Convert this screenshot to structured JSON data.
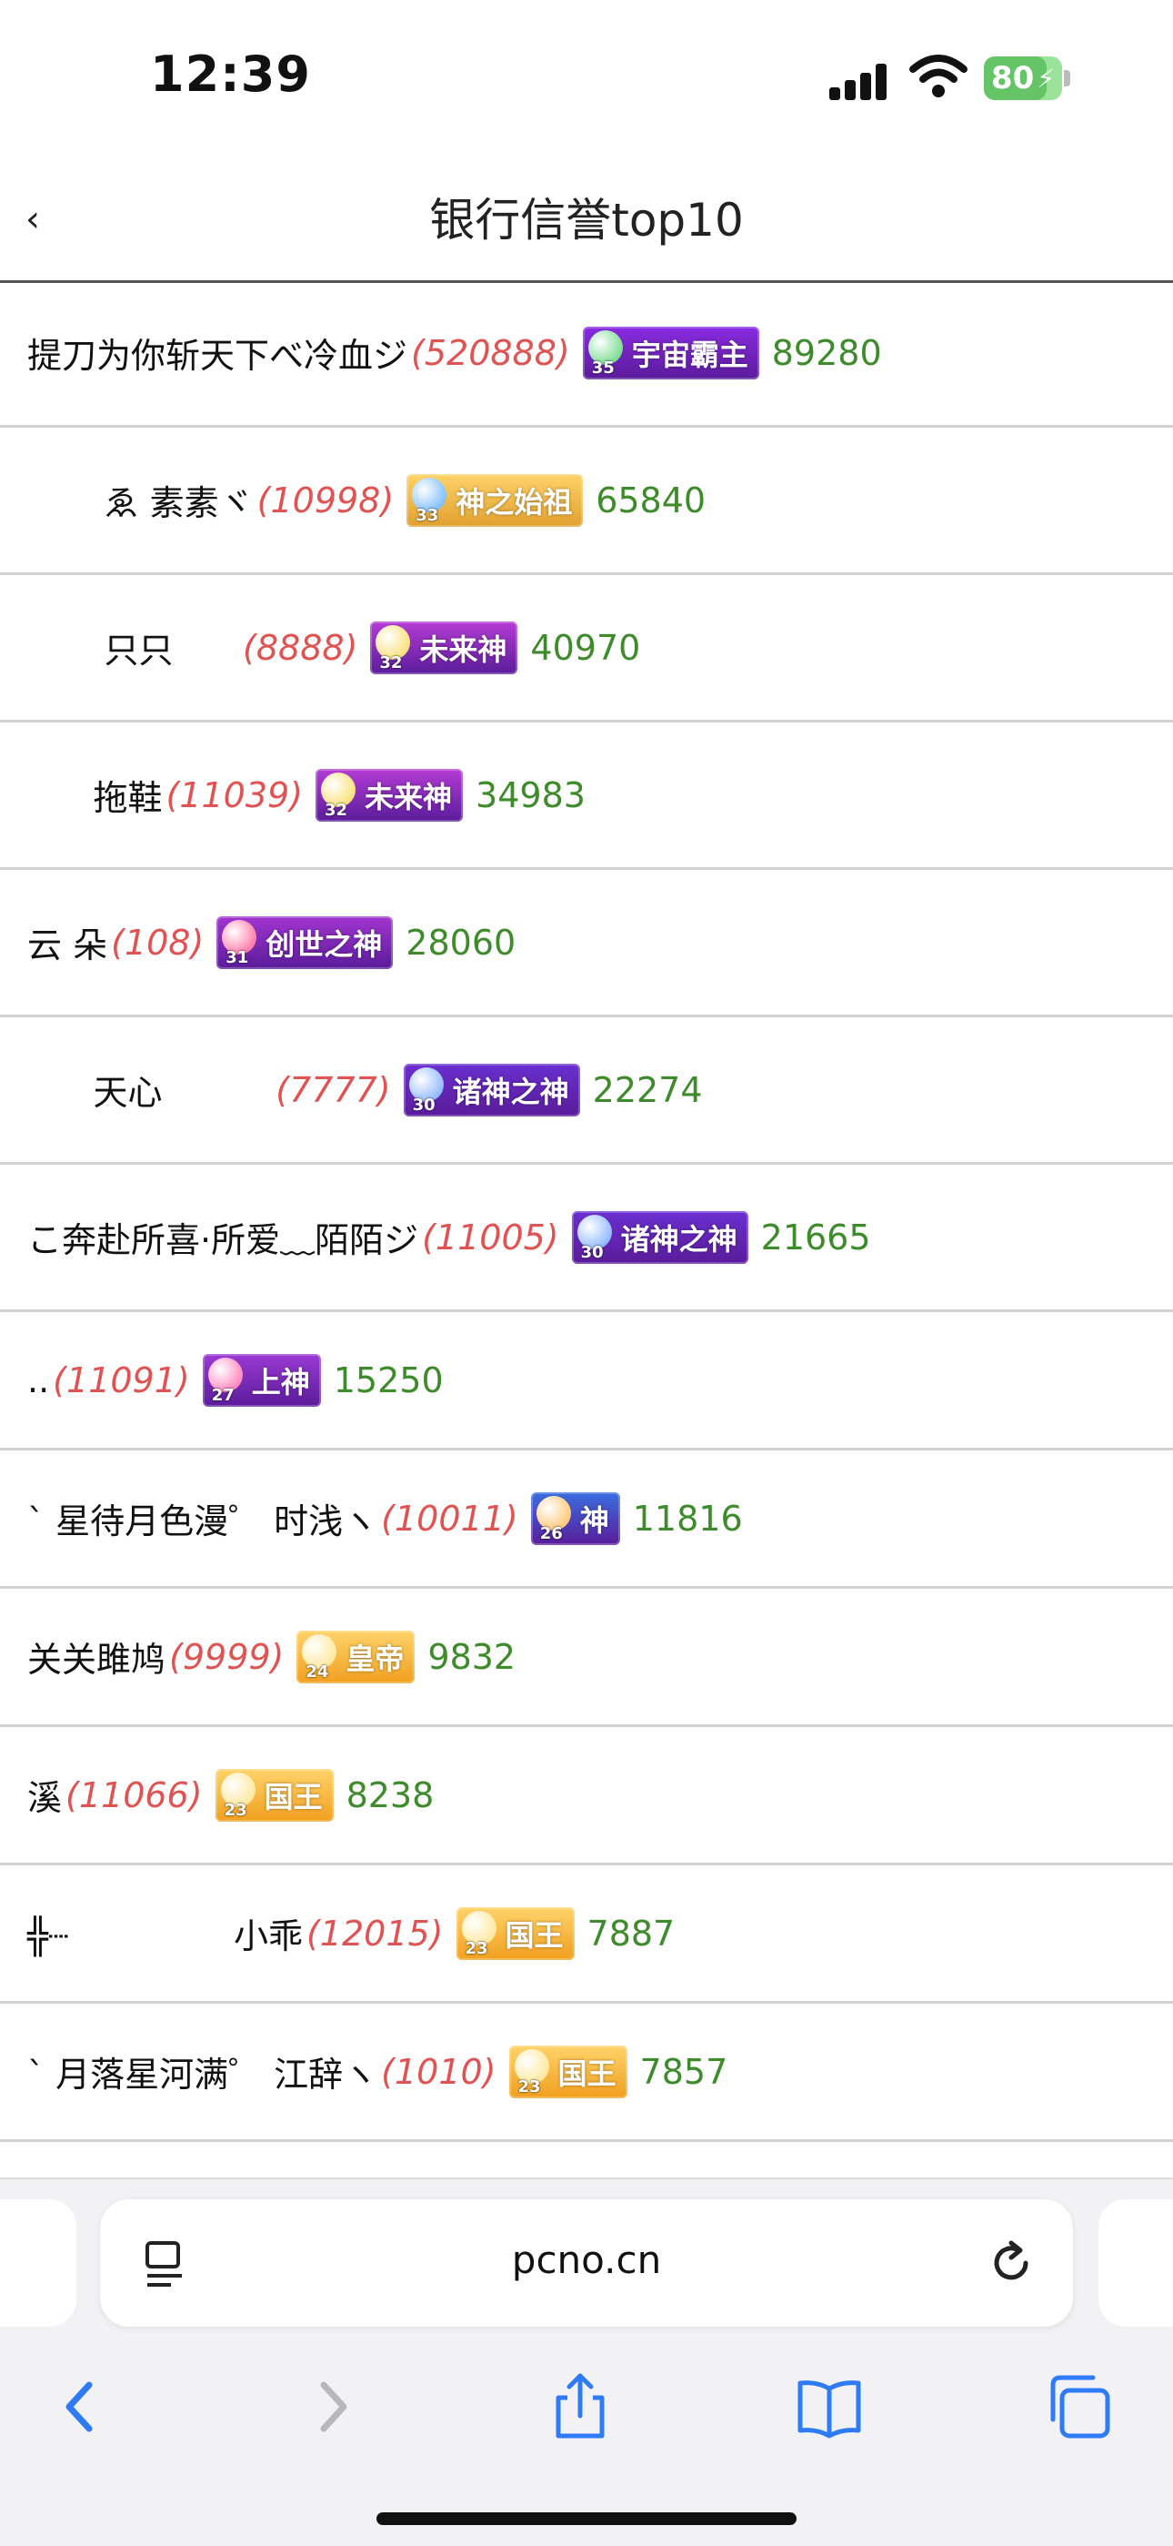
{
  "status_bar": {
    "time": "12:39",
    "battery": "80",
    "battery_level": 0.8
  },
  "header": {
    "title": "银行信誉top10"
  },
  "rows": [
    {
      "name": "提刀为你斩天下べ冷血ジ",
      "id": "(520888)",
      "badge_title": "宇宙霸主",
      "badge_level": "35",
      "score": "89280"
    },
    {
      "name": "       ゑ 素素ヾ",
      "id": "(10998)",
      "badge_title": "神之始祖",
      "badge_level": "33",
      "score": "65840"
    },
    {
      "name": "       只只",
      "id": "      (8888)",
      "badge_title": "未来神",
      "badge_level": "32",
      "score": "40970"
    },
    {
      "name": "      拖鞋",
      "id": "(11039)",
      "badge_title": "未来神",
      "badge_level": "32",
      "score": "34983"
    },
    {
      "name": "云 朵",
      "id": "(108)",
      "badge_title": "创世之神",
      "badge_level": "31",
      "score": "28060"
    },
    {
      "name": "      天心",
      "id": "          (7777)",
      "badge_title": "诸神之神",
      "badge_level": "30",
      "score": "22274"
    },
    {
      "name": "こ奔赴所喜·所爱﹏陌陌ジ",
      "id": "(11005)",
      "badge_title": "诸神之神",
      "badge_level": "30",
      "score": "21665"
    },
    {
      "name": "..",
      "id": "(11091)",
      "badge_title": "上神",
      "badge_level": "27",
      "score": "15250"
    },
    {
      "name": "ˋ 星待月色漫゜ 时浅ヽ",
      "id": "(10011)",
      "badge_title": "神",
      "badge_level": "26",
      "score": "11816"
    },
    {
      "name": "关关雎鸠",
      "id": "(9999)",
      "badge_title": "皇帝",
      "badge_level": "24",
      "score": "9832"
    },
    {
      "name": "溪",
      "id": "(11066)",
      "badge_title": "国王",
      "badge_level": "23",
      "score": "8238"
    },
    {
      "name": "╬┈               小乖",
      "id": "(12015)",
      "badge_title": "国王",
      "badge_level": "23",
      "score": "7887"
    },
    {
      "name": "ˋ 月落星河满゜ 江辞ヽ",
      "id": "(1010)",
      "badge_title": "国王",
      "badge_level": "23",
      "score": "7857"
    }
  ],
  "badge_colors": {
    "宇宙霸主": "#8a2be2",
    "神之始祖": "#e0a030",
    "未来神": "#b53cd6",
    "创世之神": "#a235d0",
    "诸神之神": "#6a2fd0",
    "上神": "#9b3ad4",
    "神": "#3a6ee0",
    "皇帝": "#f0a020",
    "国王": "#f0a020"
  },
  "browser": {
    "url": "pcno.cn"
  },
  "icons": [
    "back-chevron-icon",
    "signal-icon",
    "wifi-icon",
    "battery-icon",
    "reader-icon",
    "reload-icon",
    "back-icon",
    "forward-icon",
    "share-icon",
    "bookmarks-icon",
    "tabs-icon"
  ]
}
